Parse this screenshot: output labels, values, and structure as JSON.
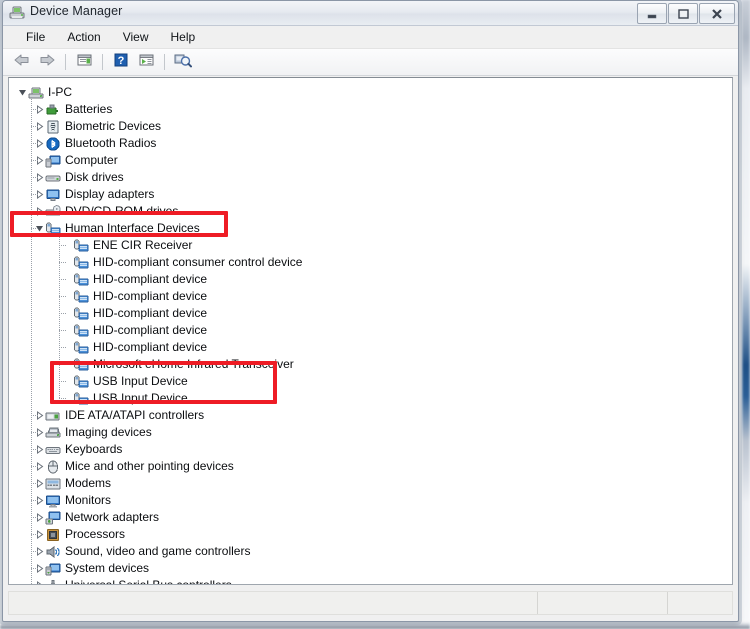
{
  "window": {
    "title": "Device Manager",
    "app_icon": "device-manager-icon",
    "controls": {
      "minimize": "Minimize",
      "maximize": "Maximize",
      "close": "Close"
    }
  },
  "menubar": {
    "items": [
      {
        "label": "File",
        "name": "menu-file"
      },
      {
        "label": "Action",
        "name": "menu-action"
      },
      {
        "label": "View",
        "name": "menu-view"
      },
      {
        "label": "Help",
        "name": "menu-help"
      }
    ]
  },
  "toolbar": {
    "buttons": [
      {
        "name": "back-button",
        "icon": "back-arrow-icon",
        "tooltip": "Back"
      },
      {
        "name": "forward-button",
        "icon": "forward-arrow-icon",
        "tooltip": "Forward"
      },
      {
        "name": "properties-button",
        "icon": "properties-icon",
        "tooltip": "Properties"
      },
      {
        "name": "help-button",
        "icon": "help-question-icon",
        "tooltip": "Help"
      },
      {
        "name": "update-driver-button",
        "icon": "update-driver-icon",
        "tooltip": "Update Driver Software"
      },
      {
        "name": "scan-hardware-button",
        "icon": "scan-hardware-changes-icon",
        "tooltip": "Scan for hardware changes"
      }
    ]
  },
  "tree": {
    "root": {
      "label": "I-PC",
      "icon": "computer-root-icon",
      "level": 0,
      "expanded": true
    },
    "items": [
      {
        "label": "Batteries",
        "icon": "battery-icon",
        "level": 1,
        "expandable": true,
        "expanded": false
      },
      {
        "label": "Biometric Devices",
        "icon": "biometric-icon",
        "level": 1,
        "expandable": true,
        "expanded": false
      },
      {
        "label": "Bluetooth Radios",
        "icon": "bluetooth-icon",
        "level": 1,
        "expandable": true,
        "expanded": false
      },
      {
        "label": "Computer",
        "icon": "computer-icon",
        "level": 1,
        "expandable": true,
        "expanded": false
      },
      {
        "label": "Disk drives",
        "icon": "disk-drive-icon",
        "level": 1,
        "expandable": true,
        "expanded": false
      },
      {
        "label": "Display adapters",
        "icon": "display-adapter-icon",
        "level": 1,
        "expandable": true,
        "expanded": false
      },
      {
        "label": "DVD/CD-ROM drives",
        "icon": "dvd-drive-icon",
        "level": 1,
        "expandable": true,
        "expanded": false
      },
      {
        "label": "Human Interface Devices",
        "icon": "hid-icon",
        "level": 1,
        "expandable": true,
        "expanded": true,
        "highlighted": true
      },
      {
        "label": "ENE CIR Receiver",
        "icon": "hid-icon",
        "level": 2,
        "expandable": false
      },
      {
        "label": "HID-compliant consumer control device",
        "icon": "hid-icon",
        "level": 2,
        "expandable": false
      },
      {
        "label": "HID-compliant device",
        "icon": "hid-icon",
        "level": 2,
        "expandable": false
      },
      {
        "label": "HID-compliant device",
        "icon": "hid-icon",
        "level": 2,
        "expandable": false
      },
      {
        "label": "HID-compliant device",
        "icon": "hid-icon",
        "level": 2,
        "expandable": false
      },
      {
        "label": "HID-compliant device",
        "icon": "hid-icon",
        "level": 2,
        "expandable": false
      },
      {
        "label": "HID-compliant device",
        "icon": "hid-icon",
        "level": 2,
        "expandable": false
      },
      {
        "label": "Microsoft eHome Infrared Transceiver",
        "icon": "hid-icon",
        "level": 2,
        "expandable": false
      },
      {
        "label": "USB Input Device",
        "icon": "hid-icon",
        "level": 2,
        "expandable": false,
        "highlighted": true
      },
      {
        "label": "USB Input Device",
        "icon": "hid-icon",
        "level": 2,
        "expandable": false,
        "highlighted": true
      },
      {
        "label": "IDE ATA/ATAPI controllers",
        "icon": "ide-controller-icon",
        "level": 1,
        "expandable": true,
        "expanded": false
      },
      {
        "label": "Imaging devices",
        "icon": "imaging-device-icon",
        "level": 1,
        "expandable": true,
        "expanded": false
      },
      {
        "label": "Keyboards",
        "icon": "keyboard-icon",
        "level": 1,
        "expandable": true,
        "expanded": false
      },
      {
        "label": "Mice and other pointing devices",
        "icon": "mouse-icon",
        "level": 1,
        "expandable": true,
        "expanded": false
      },
      {
        "label": "Modems",
        "icon": "modem-icon",
        "level": 1,
        "expandable": true,
        "expanded": false
      },
      {
        "label": "Monitors",
        "icon": "monitor-icon",
        "level": 1,
        "expandable": true,
        "expanded": false
      },
      {
        "label": "Network adapters",
        "icon": "network-adapter-icon",
        "level": 1,
        "expandable": true,
        "expanded": false
      },
      {
        "label": "Processors",
        "icon": "processor-icon",
        "level": 1,
        "expandable": true,
        "expanded": false
      },
      {
        "label": "Sound, video and game controllers",
        "icon": "sound-controller-icon",
        "level": 1,
        "expandable": true,
        "expanded": false
      },
      {
        "label": "System devices",
        "icon": "system-device-icon",
        "level": 1,
        "expandable": true,
        "expanded": false
      },
      {
        "label": "Universal Serial Bus controllers",
        "icon": "usb-controller-icon",
        "level": 1,
        "expandable": true,
        "expanded": false
      }
    ]
  },
  "statusbar": {
    "segments": [
      "",
      "",
      ""
    ]
  },
  "annotations": [
    {
      "name": "annotation-box-human-interface-devices",
      "color": "#ee1c25",
      "target": "Human Interface Devices"
    },
    {
      "name": "annotation-box-usb-input-devices",
      "color": "#ee1c25",
      "target": "USB Input Device"
    }
  ],
  "colors": {
    "annotation_red": "#ee1c25",
    "window_frame": "#8b96a6",
    "content_background": "#ffffff",
    "chrome_background": "#f0f0f0"
  }
}
